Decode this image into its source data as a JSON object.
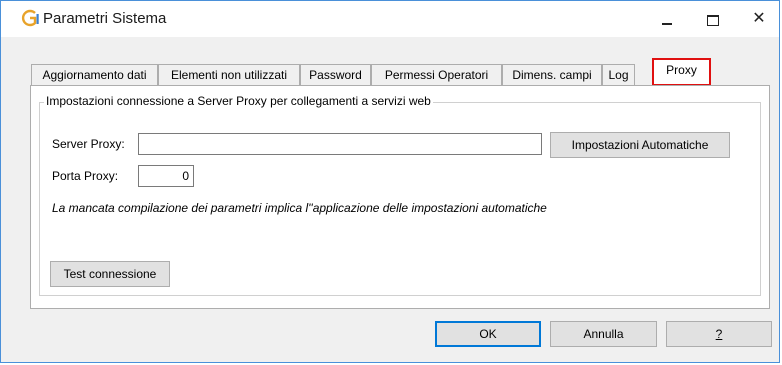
{
  "window": {
    "title": "Parametri Sistema",
    "controls": {
      "minimize": "_",
      "maximize": "□",
      "close": "✕"
    }
  },
  "tabs": [
    {
      "label": "Aggiornamento dati",
      "active": false
    },
    {
      "label": "Elementi non utilizzati",
      "active": false
    },
    {
      "label": "Password",
      "active": false
    },
    {
      "label": "Permessi Operatori",
      "active": false
    },
    {
      "label": "Dimens. campi",
      "active": false
    },
    {
      "label": "Log",
      "active": false
    },
    {
      "label": "Proxy",
      "active": true
    }
  ],
  "proxy": {
    "group_title": "Impostazioni connessione a Server Proxy per collegamenti a servizi web",
    "server_label": "Server Proxy:",
    "server_value": "",
    "auto_settings_button": "Impostazioni Automatiche",
    "port_label": "Porta Proxy:",
    "port_value": "0",
    "note": "La mancata compilazione dei parametri implica l''applicazione delle impostazioni automatiche",
    "test_button": "Test connessione"
  },
  "footer": {
    "ok": "OK",
    "cancel": "Annulla",
    "help": "?"
  },
  "colors": {
    "highlight": "#e01010",
    "default_button_border": "#0078d7",
    "window_border": "#4a90d9"
  }
}
